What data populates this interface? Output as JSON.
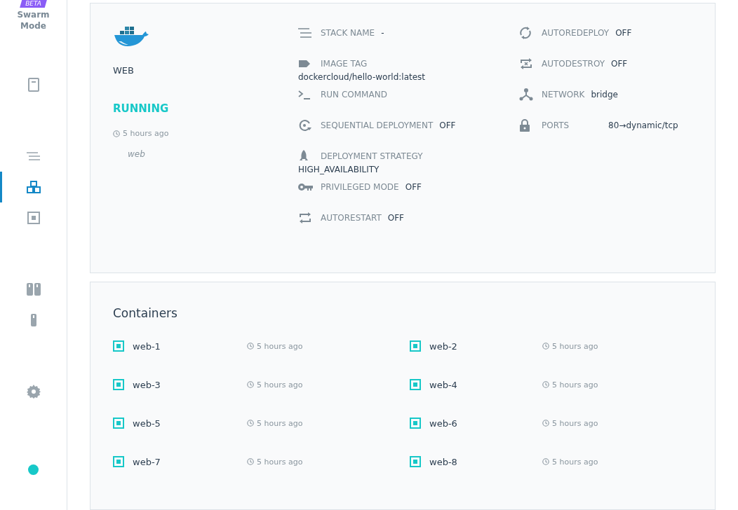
{
  "sidebar": {
    "badge": "BETA",
    "title": "Swarm Mode",
    "items": [
      {
        "selected": false
      },
      {
        "selected": false
      },
      {
        "selected": true
      },
      {
        "selected": false
      },
      {
        "selected": false
      },
      {
        "selected": false
      },
      {
        "selected": false
      }
    ],
    "status_dot": {
      "color": "#17c8c8"
    }
  },
  "service": {
    "name": "WEB",
    "state": "RUNNING",
    "time": "5 hours ago",
    "tag": "web"
  },
  "details": [
    [
      {
        "label": "STACK NAME",
        "value": "-",
        "kind": "inline"
      },
      {
        "label": "IMAGE TAG",
        "value": "dockercloud/hello-world:latest",
        "kind": "stacked"
      },
      {
        "label": "RUN COMMAND",
        "kind": "inline"
      },
      {
        "label": "SEQUENTIAL DEPLOYMENT",
        "value": "OFF",
        "kind": "inline"
      },
      {
        "label": "DEPLOYMENT STRATEGY",
        "value": "HIGH_AVAILABILITY",
        "kind": "stacked"
      },
      {
        "label": "PRIVILEGED MODE",
        "value": "OFF",
        "kind": "inline"
      },
      {
        "label": "AUTORESTART",
        "value": "OFF",
        "kind": "inline"
      }
    ],
    [
      {
        "label": "AUTOREDEPLOY",
        "value": "OFF",
        "kind": "inline"
      },
      {
        "label": "AUTODESTROY",
        "value": "OFF",
        "kind": "inline"
      },
      {
        "label": "NETWORK",
        "value": "bridge",
        "kind": "inline"
      },
      {
        "label": "PORTS",
        "value": "80→dynamic/tcp",
        "kind": "spaced"
      }
    ]
  ],
  "containers": {
    "title": "Containers",
    "items": [
      {
        "name": "web-1",
        "time": "5 hours ago"
      },
      {
        "name": "web-2",
        "time": "5 hours ago"
      },
      {
        "name": "web-3",
        "time": "5 hours ago"
      },
      {
        "name": "web-4",
        "time": "5 hours ago"
      },
      {
        "name": "web-5",
        "time": "5 hours ago"
      },
      {
        "name": "web-6",
        "time": "5 hours ago"
      },
      {
        "name": "web-7",
        "time": "5 hours ago"
      },
      {
        "name": "web-8",
        "time": "5 hours ago"
      }
    ]
  }
}
